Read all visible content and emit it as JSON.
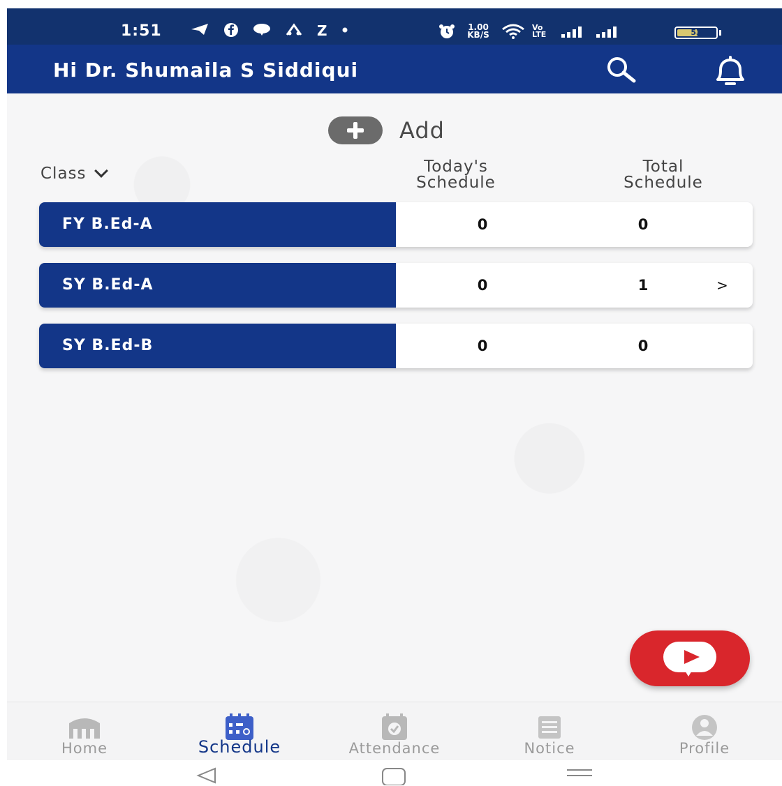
{
  "status_bar": {
    "time": "1:51",
    "notif_icons": [
      "telegram-icon",
      "facebook-icon",
      "chat-icon",
      "app-icon",
      "z-icon",
      "dot-icon"
    ],
    "z_text": "Z",
    "speed_value": "1.00",
    "speed_unit": "KB/S",
    "volte": "Vo LTE",
    "battery": "53",
    "battery_level": 0.53
  },
  "header": {
    "title": "Hi Dr. Shumaila S Siddiqui",
    "icons": [
      "search-icon",
      "bell-icon"
    ]
  },
  "add": {
    "label": "Add",
    "icon": "plus-circle-icon"
  },
  "table": {
    "filter_label": "Class",
    "col_today_line1": "Today's",
    "col_today_line2": "Schedule",
    "col_total_line1": "Total",
    "col_total_line2": "Schedule",
    "rows": [
      {
        "name": "FY B.Ed-A",
        "today": "0",
        "total": "0",
        "arrow": ""
      },
      {
        "name": "SY B.Ed-A",
        "today": "0",
        "total": "1",
        "arrow": ">"
      },
      {
        "name": "SY B.Ed-B",
        "today": "0",
        "total": "0",
        "arrow": ""
      }
    ]
  },
  "fab": {
    "icon": "video-play-icon"
  },
  "bottom_nav": {
    "items": [
      {
        "label": "Home",
        "icon": "home-icon",
        "active": false
      },
      {
        "label": "Schedule",
        "icon": "calendar-icon",
        "active": true
      },
      {
        "label": "Attendance",
        "icon": "attendance-icon",
        "active": false
      },
      {
        "label": "Notice",
        "icon": "notice-icon",
        "active": false
      },
      {
        "label": "Profile",
        "icon": "profile-icon",
        "active": false
      }
    ]
  },
  "system_nav": {
    "icons": [
      "back-icon",
      "home-square-icon",
      "recents-icon"
    ]
  },
  "colors": {
    "primary": "#133688",
    "accent_red": "#d9262c",
    "inactive": "#9a9a9a"
  }
}
